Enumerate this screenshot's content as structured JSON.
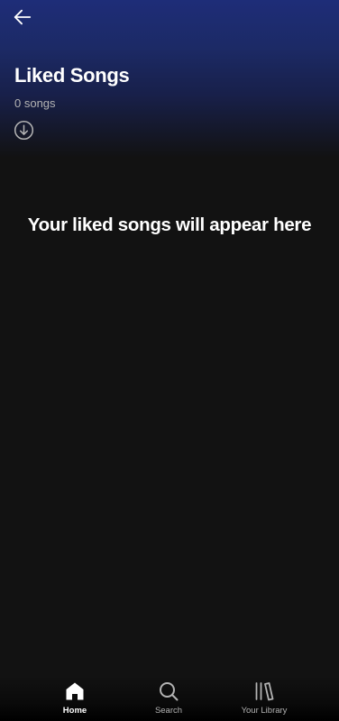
{
  "header": {
    "title": "Liked Songs",
    "song_count": "0 songs",
    "gradient_color": "#1e2d78"
  },
  "icons": {
    "back": "arrow-left-icon",
    "download": "download-circle-icon",
    "home": "home-icon",
    "search": "search-icon",
    "library": "library-icon"
  },
  "main": {
    "empty_message": "Your liked songs will appear here"
  },
  "bottom_nav": {
    "items": [
      {
        "label": "Home",
        "icon": "home-icon",
        "active": true
      },
      {
        "label": "Search",
        "icon": "search-icon",
        "active": false
      },
      {
        "label": "Your Library",
        "icon": "library-icon",
        "active": false
      }
    ]
  },
  "colors": {
    "background": "#121212",
    "secondary_text": "#b3b3b3",
    "primary_text": "#ffffff"
  }
}
